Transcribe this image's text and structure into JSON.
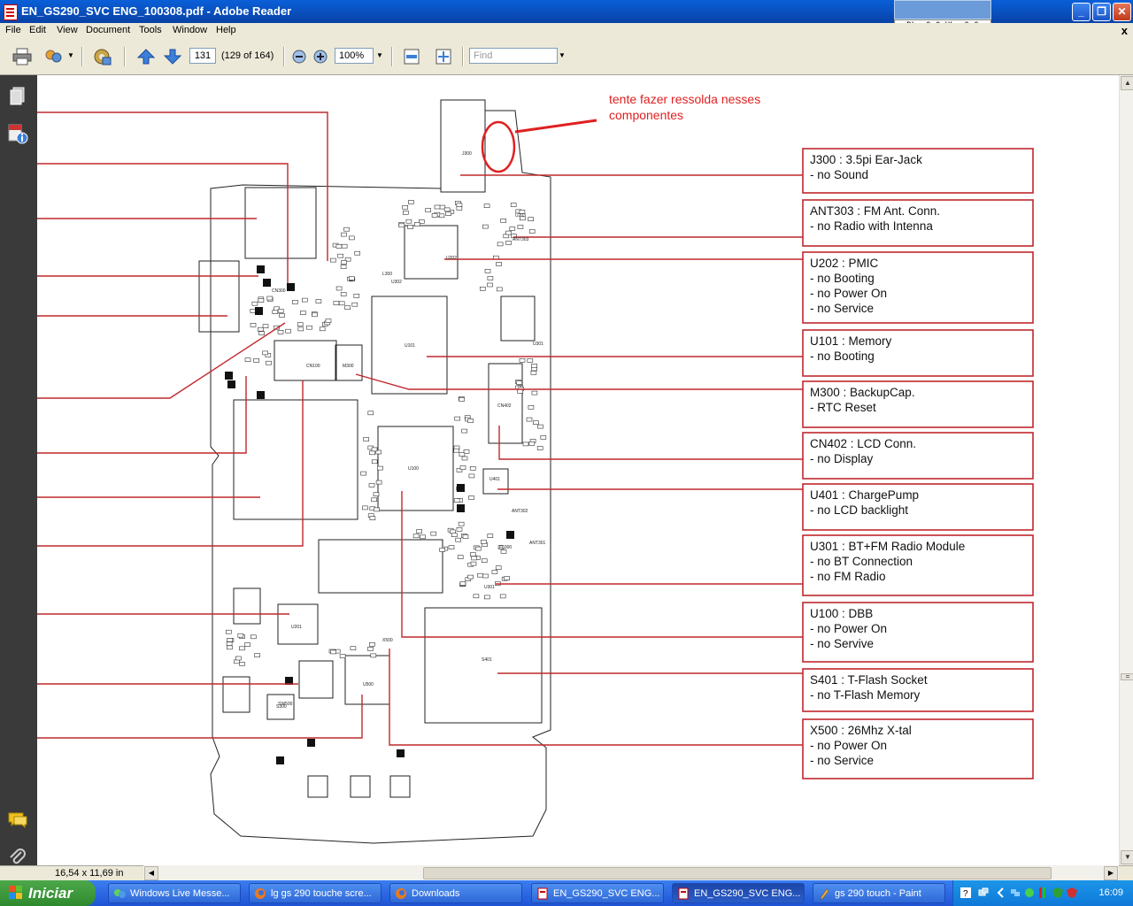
{
  "window": {
    "title": "EN_GS290_SVC ENG_100308.pdf - Adobe Reader",
    "net_meter": "DL: 0.0 UL: 0.0",
    "min_label": "_",
    "max_label": "❐",
    "close_label": "✕"
  },
  "menu": {
    "items": [
      "File",
      "Edit",
      "View",
      "Document",
      "Tools",
      "Window",
      "Help"
    ],
    "close_label": "x"
  },
  "toolbar": {
    "page_current": "131",
    "page_info": "(129 of 164)",
    "zoom": "100%",
    "find_placeholder": "Find"
  },
  "document": {
    "annotation": [
      "tente fazer ressolda nesses",
      "componentes"
    ],
    "callouts": [
      {
        "title": "J300 : 3.5pi Ear-Jack",
        "lines": [
          "- no Sound"
        ]
      },
      {
        "title": "ANT303 : FM Ant. Conn.",
        "lines": [
          "- no Radio with Intenna"
        ]
      },
      {
        "title": "U202 : PMIC",
        "lines": [
          "- no Booting",
          "- no Power On",
          "- no Service"
        ]
      },
      {
        "title": "U101 : Memory",
        "lines": [
          "- no Booting"
        ]
      },
      {
        "title": "M300 : BackupCap.",
        "lines": [
          " - RTC Reset"
        ]
      },
      {
        "title": "CN402 : LCD Conn.",
        "lines": [
          "- no Display"
        ]
      },
      {
        "title": "U401 : ChargePump",
        "lines": [
          " - no LCD backlight"
        ]
      },
      {
        "title": "U301 : BT+FM Radio Module",
        "lines": [
          "- no BT Connection",
          "- no FM Radio"
        ]
      },
      {
        "title": "U100 : DBB",
        "lines": [
          "- no Power On",
          "- no Servive"
        ]
      },
      {
        "title": "S401 : T-Flash Socket",
        "lines": [
          " - no T-Flash Memory"
        ]
      },
      {
        "title": "X500 : 26Mhz X-tal",
        "lines": [
          "- no Power On",
          "- no Service"
        ]
      }
    ],
    "board_labels": [
      "U100",
      "U101",
      "U202",
      "U301",
      "U401",
      "S401",
      "X500",
      "J300",
      "CN402",
      "M300",
      "CN100",
      "U500",
      "U302",
      "U201",
      "U301",
      "CN300",
      "S300",
      "L300",
      "U203",
      "FL300",
      "ANT301",
      "ANT302",
      "ANT303",
      "SW500"
    ]
  },
  "status": {
    "page_size": "16,54 x 11,69 in"
  },
  "taskbar": {
    "start_label": "Iniciar",
    "tasks": [
      {
        "label": "Windows Live Messe...",
        "active": false
      },
      {
        "label": "lg gs 290 touche scre...",
        "active": false
      },
      {
        "label": "Downloads",
        "active": false
      },
      {
        "label": "EN_GS290_SVC ENG...",
        "active": false
      },
      {
        "label": "EN_GS290_SVC ENG...",
        "active": true
      },
      {
        "label": "gs 290 touch - Paint",
        "active": false
      }
    ],
    "clock": "16:09",
    "colors": {
      "start": "#3c9a3a",
      "taskbar": "#245edb",
      "tray": "#0f85dc"
    }
  },
  "colors": {
    "callout_red": "#c0282c",
    "annotation_red": "#e02020"
  }
}
